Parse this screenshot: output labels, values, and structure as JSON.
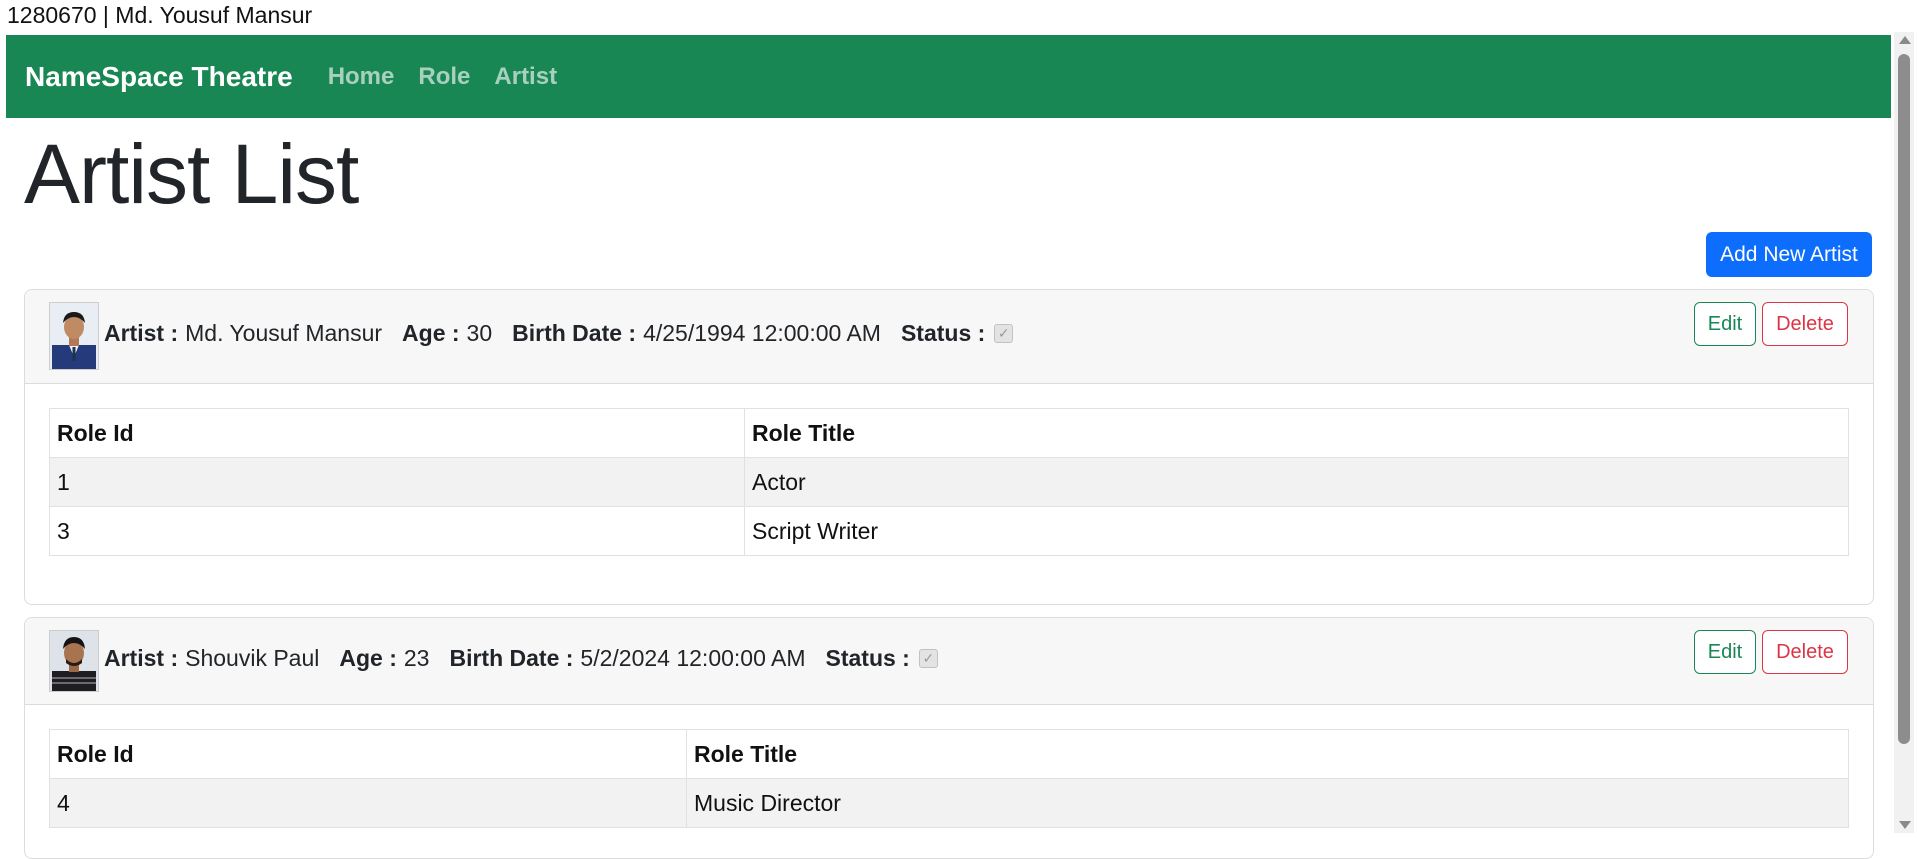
{
  "page_header": "1280670 | Md. Yousuf Mansur",
  "navbar": {
    "brand": "NameSpace Theatre",
    "links": [
      "Home",
      "Role",
      "Artist"
    ],
    "background": "#198754"
  },
  "title": "Artist List",
  "add_button": "Add New Artist",
  "labels": {
    "artist": "Artist :",
    "age": "Age :",
    "birth_date": "Birth Date :",
    "status": "Status :",
    "role_id": "Role Id",
    "role_title": "Role Title",
    "edit": "Edit",
    "delete": "Delete"
  },
  "artists": [
    {
      "name": "Md. Yousuf Mansur",
      "age": "30",
      "birth_date": "4/25/1994 12:00:00 AM",
      "status_checked": true,
      "roles": [
        {
          "id": "1",
          "title": "Actor"
        },
        {
          "id": "3",
          "title": "Script Writer"
        }
      ]
    },
    {
      "name": "Shouvik Paul",
      "age": "23",
      "birth_date": "5/2/2024 12:00:00 AM",
      "status_checked": true,
      "roles": [
        {
          "id": "4",
          "title": "Music Director"
        }
      ]
    }
  ],
  "colors": {
    "primary": "#0d6efd",
    "success": "#198754",
    "danger": "#dc3545"
  }
}
